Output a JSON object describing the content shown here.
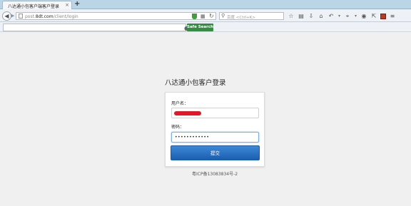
{
  "browser": {
    "tab_title": "八达通小包客户端客户登录",
    "tab_close": "×",
    "new_tab": "+",
    "url_prefix": "post.",
    "url_domain": "8dt.com",
    "url_path": "/client/login",
    "search_placeholder": "百度 <Ctrl+K>",
    "search_button": "Safe Search"
  },
  "login": {
    "title": "八达通小包客户登录",
    "username_label": "用户名：",
    "password_label": "密码：",
    "password_value": "••••••••••••",
    "submit_label": "提交"
  },
  "footer": {
    "icp": "粤ICP备13083834号-2"
  },
  "colors": {
    "search_button": "#2f8f3c",
    "submit_button": "#1b5fae",
    "redaction": "#e0182a"
  }
}
